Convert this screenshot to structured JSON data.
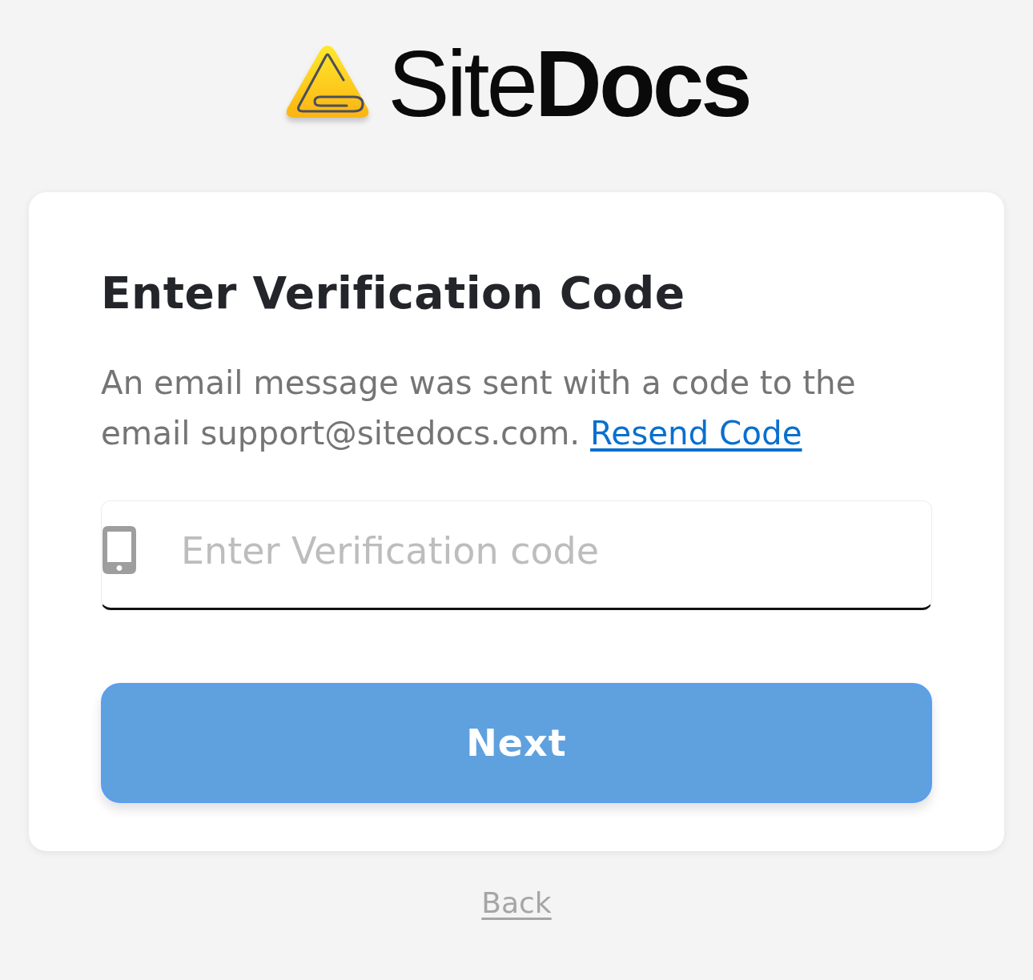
{
  "logo": {
    "wordmark": "Site**Docs**"
  },
  "card": {
    "title": "Enter Verification Code",
    "message": "An email message was sent with a code to the email support@sitedocs.com.",
    "resend_link": "Resend Code",
    "code_field": {
      "placeholder": "Enter Verification code"
    },
    "next_button": {
      "label": "Next"
    }
  },
  "back_link": "Back"
}
